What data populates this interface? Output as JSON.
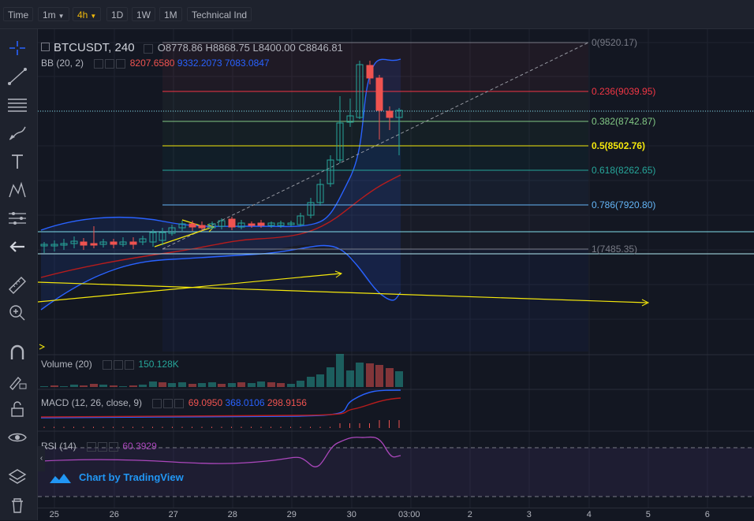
{
  "toolbar": {
    "time": "Time",
    "interval_1m": "1m",
    "interval_4h": "4h",
    "range_1d": "1D",
    "range_1w": "1W",
    "range_1m": "1M",
    "indicators": "Technical Ind"
  },
  "main": {
    "symbol": "BTCUSDT, 240",
    "open": "O8778.86",
    "high": "H8868.75",
    "low": "L8400.00",
    "close": "C8846.81",
    "bb_label": "BB (20, 2)",
    "bb_v1": "8207.6580",
    "bb_v2": "9332.2073",
    "bb_v3": "7083.0847"
  },
  "fib": {
    "l0": "0(9520.17)",
    "l236": "0.236(9039.95)",
    "l382": "0.382(8742.87)",
    "l5": "0.5(8502.76)",
    "l618": "0.618(8262.65)",
    "l786": "0.786(7920.80)",
    "l1": "1(7485.35)"
  },
  "volume": {
    "label": "Volume (20)",
    "value": "150.128K"
  },
  "macd": {
    "label": "MACD (12, 26, close, 9)",
    "v1": "69.0950",
    "v2": "368.0106",
    "v3": "298.9156"
  },
  "rsi": {
    "label": "RSI (14)",
    "value": "60.3929"
  },
  "branding": "Chart by TradingView",
  "xaxis": [
    "25",
    "26",
    "27",
    "28",
    "29",
    "30",
    "03:00",
    "2",
    "3",
    "4",
    "5",
    "6"
  ],
  "colors": {
    "up": "#26a69a",
    "down": "#ef5350",
    "bb_band": "#2962ff",
    "bb_basis": "#b71c1c",
    "accent": "#f0b90b",
    "trend": "#f5e80c"
  }
}
